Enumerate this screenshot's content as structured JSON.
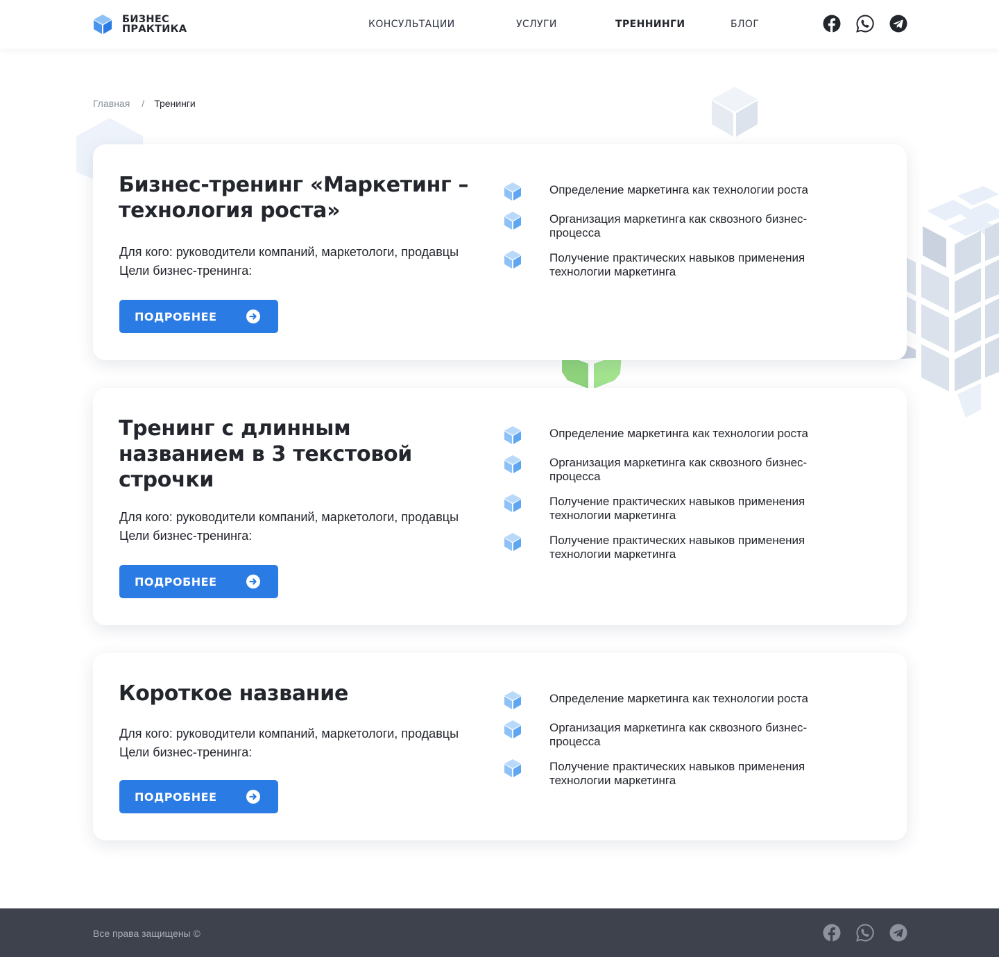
{
  "brand": {
    "line1": "БИЗНЕС",
    "line2": "ПРАКТИКА",
    "colors": {
      "primary": "#2b7be4",
      "text": "#23262d",
      "footer": "#3d424d",
      "accent_green": "#7fd36b"
    }
  },
  "nav": {
    "items": [
      {
        "label": "КОНСУЛЬТАЦИИ"
      },
      {
        "label": "УСЛУГИ"
      },
      {
        "label": "ТРЕННИНГИ",
        "active": true
      },
      {
        "label": "БЛОГ"
      }
    ],
    "social": [
      "facebook-icon",
      "whatsapp-icon",
      "telegram-icon"
    ]
  },
  "breadcrumb": {
    "home": "Главная",
    "separator": "/",
    "current": "Тренинги"
  },
  "cards": [
    {
      "title": "Бизнес-тренинг «Маркетинг – технология роста»",
      "audience": "Для кого: руководители компаний, маркетологи, продавцы",
      "goals_label": "Цели бизнес-тренинга:",
      "button": "ПОДРОБНЕЕ",
      "goals": [
        "Определение маркетинга как технологии роста",
        "Организация маркетинга как сквозного бизнес-процесса",
        "Получение практических навыков применения технологии маркетинга"
      ]
    },
    {
      "title": "Тренинг с длинным названием в 3 текстовой строчки",
      "audience": "Для кого: руководители компаний, маркетологи, продавцы",
      "goals_label": "Цели бизнес-тренинга:",
      "button": "ПОДРОБНЕЕ",
      "goals": [
        "Определение маркетинга как технологии роста",
        "Организация маркетинга как сквозного бизнес-процесса",
        "Получение практических навыков применения технологии маркетинга",
        "Получение практических навыков применения технологии маркетинга"
      ]
    },
    {
      "title": "Короткое название",
      "audience": "Для кого: руководители компаний, маркетологи, продавцы",
      "goals_label": "Цели бизнес-тренинга:",
      "button": "ПОДРОБНЕЕ",
      "goals": [
        "Определение маркетинга как технологии роста",
        "Организация маркетинга как сквозного бизнес-процесса",
        "Получение практических навыков применения технологии маркетинга"
      ]
    }
  ],
  "footer": {
    "copyright": "Все права защищены ©",
    "social": [
      "facebook-icon",
      "whatsapp-icon",
      "telegram-icon"
    ]
  }
}
